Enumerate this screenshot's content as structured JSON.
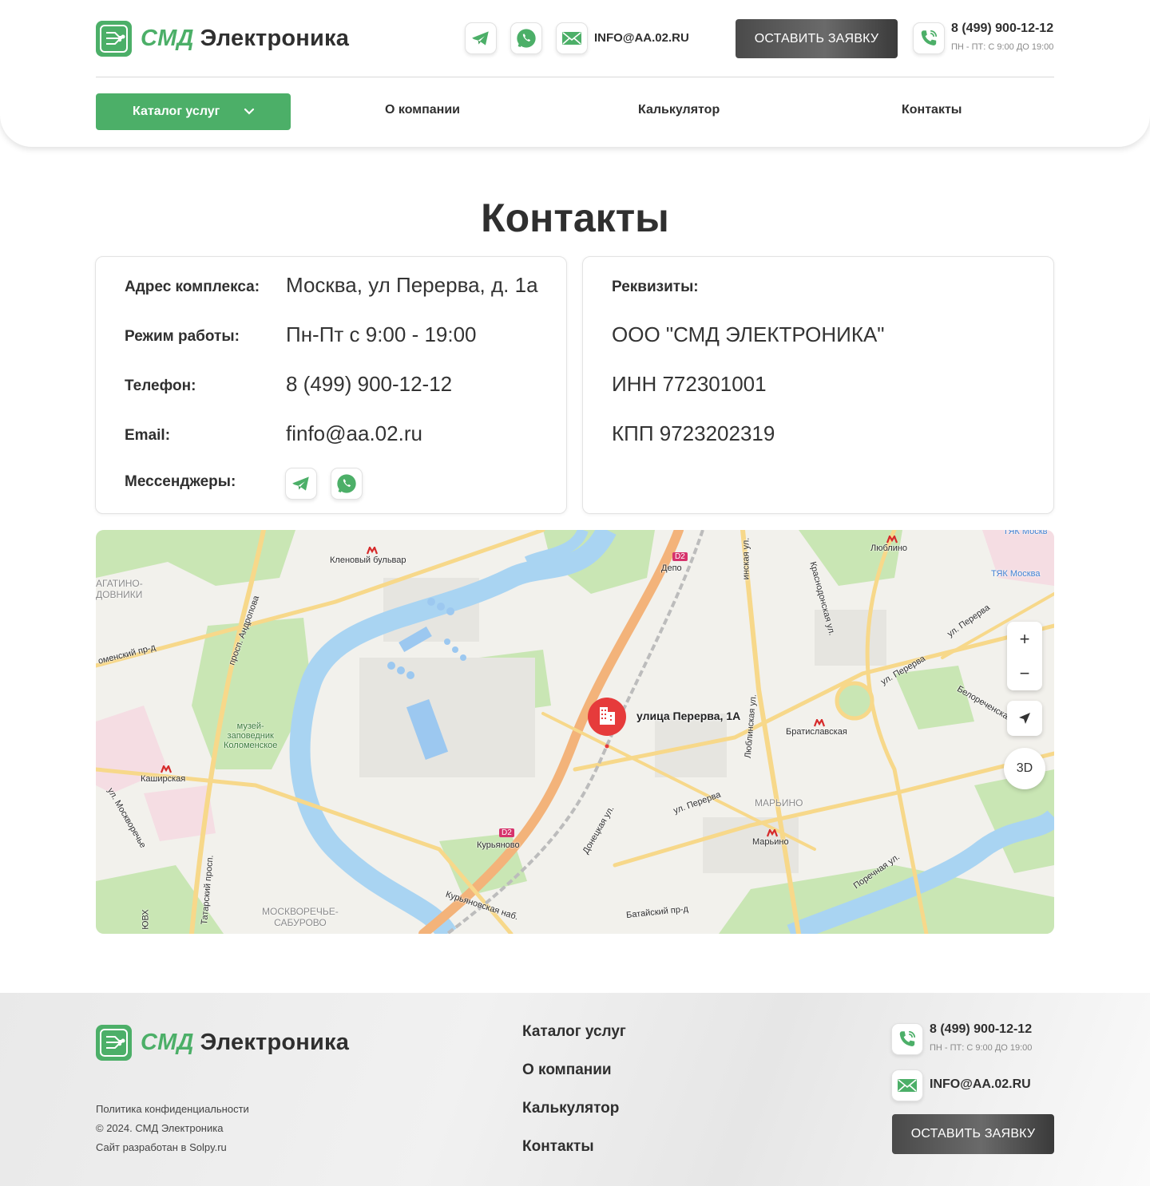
{
  "brand": {
    "name_part1": "СМД",
    "name_part2": "Электроника",
    "accent_color": "#4caf68",
    "dark_button_color": "#4a4a4a"
  },
  "header": {
    "email": "INFO@AA.02.RU",
    "cta_label": "ОСТАВИТЬ ЗАЯВКУ",
    "phone": "8 (499) 900-12-12",
    "hours": "ПН - ПТ: С 9:00 ДО 19:00",
    "icons": [
      "telegram-icon",
      "whatsapp-icon",
      "mail-icon",
      "phone-icon"
    ]
  },
  "nav": {
    "catalog_label": "Каталог услуг",
    "links": [
      "О компании",
      "Калькулятор",
      "Контакты"
    ]
  },
  "page": {
    "title": "Контакты"
  },
  "contacts": {
    "address_label": "Адрес комплекса:",
    "address_value": "Москва, ул Перерва, д. 1а",
    "hours_label": "Режим работы:",
    "hours_value": "Пн-Пт с 9:00 - 19:00",
    "phone_label": "Телефон:",
    "phone_value": "8 (499) 900-12-12",
    "email_label": "Email:",
    "email_value": "finfo@aa.02.ru",
    "messengers_label": "Мессенджеры:"
  },
  "requisites": {
    "label": "Реквизиты:",
    "company": "ООО \"СМД ЭЛЕКТРОНИКА\"",
    "inn": "ИНН 772301001",
    "kpp": "КПП 9723202319"
  },
  "map": {
    "pin_label": "улица Перерва, 1А",
    "zoom_in": "+",
    "zoom_out": "−",
    "mode_3d": "3D",
    "labels": {
      "kleno": "Кленовый бульвар",
      "depo": "Депо",
      "lyublino": "Люблино",
      "tyak1": "ТЯК Москв",
      "tyak2": "ТЯК Москва",
      "kashirskaya": "Каширская",
      "bratislavskaya": "Братиславская",
      "maryino_district": "МАРЬИНО",
      "maryino": "Марьино",
      "kuryanovo": "Курьяново",
      "museum": "музей-\nзаповедник\nКоломенское",
      "moskvorechye": "МОСКВОРЕЧЬЕ-\nСАБУРОВО",
      "nagatino": "АГАТИНО-\nДОВНИКИ",
      "andropova": "просп. Андропова",
      "kolomensky": "оменский пр-д",
      "perervy1": "ул. Перерва",
      "perervy2": "ул. Перерва",
      "perervy3": "ул. Перерва",
      "lyublinskaya": "Люблинская ул.",
      "krasnodonskaya": "Краснодонская ул.",
      "belorechenskaya": "Белореченская",
      "donetskaya": "Донецкая ул.",
      "batayskiy": "Батайский пр-д",
      "porechnaya": "Поречная ул.",
      "kuryanovskaya": "Курьяновская наб.",
      "moskvorechye_ul": "ул. Москворечье",
      "tatarsky": "Татарский просп.",
      "yuvkh": "ЮВХ",
      "inskaya": "инская ул.",
      "d2": "D2"
    }
  },
  "footer": {
    "links": [
      "Каталог услуг",
      "О компании",
      "Калькулятор",
      "Контакты"
    ],
    "privacy": "Политика конфиденциальности",
    "copyright": "© 2024. СМД Электроника",
    "developer": "Сайт разработан в Solpy.ru",
    "phone": "8 (499) 900-12-12",
    "hours": "ПН - ПТ: С 9:00 ДО 19:00",
    "email": "INFO@AA.02.RU",
    "cta_label": "ОСТАВИТЬ ЗАЯВКУ"
  }
}
